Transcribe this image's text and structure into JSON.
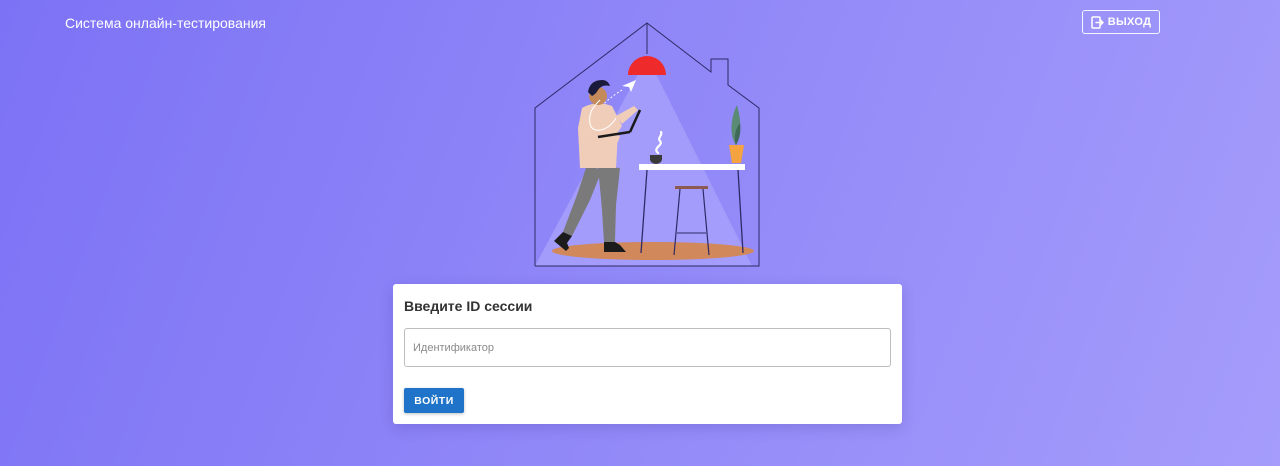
{
  "header": {
    "app_title": "Система онлайн-тестирования",
    "logout_label": "выход",
    "logout_icon": "logout-icon"
  },
  "illustration": {
    "icon": "house-illustration"
  },
  "session_card": {
    "title": "Введите ID сессии",
    "input": {
      "placeholder": "Идентификатор",
      "value": ""
    },
    "submit_label": "войти"
  },
  "colors": {
    "background_start": "#7c72f5",
    "background_end": "#a59cfb",
    "primary_button": "#1f73c8",
    "lamp": "#ee2a2a"
  }
}
